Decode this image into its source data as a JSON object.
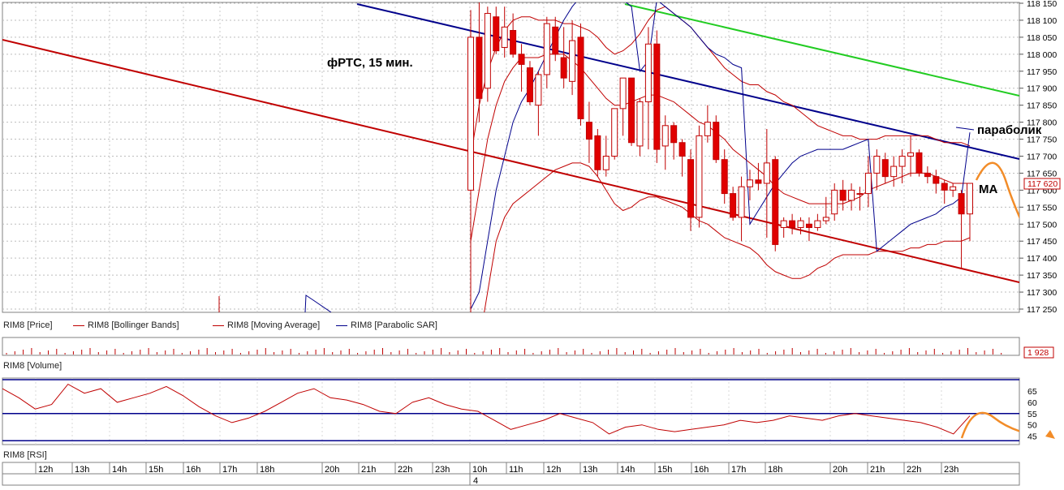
{
  "chart_data": {
    "type": "candlestick",
    "title": "фРТС, 15 мин.",
    "annotations": {
      "parabolic": "параболик",
      "ma": "MA"
    },
    "price_axis": {
      "ticks": [
        "118 150",
        "118 100",
        "118 050",
        "118 000",
        "117 950",
        "117 900",
        "117 850",
        "117 800",
        "117 750",
        "117 700",
        "117 650",
        "117 600",
        "117 550",
        "117 500",
        "117 450",
        "117 400",
        "117 350",
        "117 300",
        "117 250"
      ],
      "range": [
        117250,
        118150
      ],
      "last_price": "117 620"
    },
    "legend": {
      "price": "RIM8 [Price]",
      "bollinger": "RIM8 [Bollinger Bands]",
      "ma": "RIM8 [Moving Average]",
      "sar": "RIM8 [Parabolic SAR]"
    },
    "volume": {
      "label": "RIM8 [Volume]",
      "last_value": "1 928"
    },
    "rsi": {
      "label": "RIM8 [RSI]",
      "ticks": [
        "65",
        "60",
        "55",
        "50",
        "45"
      ],
      "range": [
        42,
        70
      ],
      "levels": [
        70,
        55,
        43
      ]
    },
    "time_axis": {
      "labels": [
        "12h",
        "13h",
        "14h",
        "15h",
        "16h",
        "17h",
        "18h",
        "20h",
        "21h",
        "22h",
        "23h",
        "10h",
        "11h",
        "12h",
        "13h",
        "14h",
        "15h",
        "16h",
        "17h",
        "18h",
        "20h",
        "21h",
        "22h",
        "23h"
      ],
      "date_label": "4"
    },
    "candles": [
      {
        "o": 117600,
        "h": 118130,
        "l": 117230,
        "c": 118050
      },
      {
        "o": 118050,
        "h": 118160,
        "l": 117800,
        "c": 117870
      },
      {
        "o": 117900,
        "h": 118140,
        "l": 117860,
        "c": 118120
      },
      {
        "o": 118110,
        "h": 118140,
        "l": 118000,
        "c": 118010
      },
      {
        "o": 118020,
        "h": 118140,
        "l": 117990,
        "c": 118080
      },
      {
        "o": 118070,
        "h": 118120,
        "l": 117990,
        "c": 118000
      },
      {
        "o": 118000,
        "h": 118030,
        "l": 117890,
        "c": 117970
      },
      {
        "o": 117960,
        "h": 117980,
        "l": 117850,
        "c": 117860
      },
      {
        "o": 117850,
        "h": 117950,
        "l": 117760,
        "c": 117940
      },
      {
        "o": 117940,
        "h": 118110,
        "l": 117900,
        "c": 118090
      },
      {
        "o": 118080,
        "h": 118110,
        "l": 117980,
        "c": 118000
      },
      {
        "o": 117990,
        "h": 118080,
        "l": 117900,
        "c": 117930
      },
      {
        "o": 117920,
        "h": 118100,
        "l": 117880,
        "c": 118040
      },
      {
        "o": 118050,
        "h": 118090,
        "l": 117790,
        "c": 117810
      },
      {
        "o": 117800,
        "h": 117860,
        "l": 117680,
        "c": 117750
      },
      {
        "o": 117760,
        "h": 117780,
        "l": 117640,
        "c": 117660
      },
      {
        "o": 117660,
        "h": 117760,
        "l": 117640,
        "c": 117700
      },
      {
        "o": 117700,
        "h": 117830,
        "l": 117690,
        "c": 117840
      },
      {
        "o": 117840,
        "h": 117930,
        "l": 117760,
        "c": 117930
      },
      {
        "o": 117930,
        "h": 117930,
        "l": 117730,
        "c": 117740
      },
      {
        "o": 117730,
        "h": 117870,
        "l": 117700,
        "c": 117860
      },
      {
        "o": 117860,
        "h": 118080,
        "l": 117720,
        "c": 118030
      },
      {
        "o": 118030,
        "h": 118070,
        "l": 117680,
        "c": 117720
      },
      {
        "o": 117730,
        "h": 117820,
        "l": 117660,
        "c": 117790
      },
      {
        "o": 117790,
        "h": 117800,
        "l": 117690,
        "c": 117740
      },
      {
        "o": 117740,
        "h": 117750,
        "l": 117640,
        "c": 117700
      },
      {
        "o": 117690,
        "h": 117720,
        "l": 117480,
        "c": 117520
      },
      {
        "o": 117520,
        "h": 117790,
        "l": 117490,
        "c": 117760
      },
      {
        "o": 117760,
        "h": 117850,
        "l": 117740,
        "c": 117800
      },
      {
        "o": 117800,
        "h": 117820,
        "l": 117680,
        "c": 117690
      },
      {
        "o": 117690,
        "h": 117720,
        "l": 117560,
        "c": 117590
      },
      {
        "o": 117590,
        "h": 117610,
        "l": 117510,
        "c": 117520
      },
      {
        "o": 117520,
        "h": 117640,
        "l": 117450,
        "c": 117610
      },
      {
        "o": 117610,
        "h": 117660,
        "l": 117570,
        "c": 117630
      },
      {
        "o": 117630,
        "h": 117680,
        "l": 117600,
        "c": 117620
      },
      {
        "o": 117620,
        "h": 117780,
        "l": 117460,
        "c": 117680
      },
      {
        "o": 117690,
        "h": 117700,
        "l": 117420,
        "c": 117440
      },
      {
        "o": 117490,
        "h": 117520,
        "l": 117460,
        "c": 117510
      },
      {
        "o": 117510,
        "h": 117530,
        "l": 117470,
        "c": 117490
      },
      {
        "o": 117490,
        "h": 117520,
        "l": 117470,
        "c": 117510
      },
      {
        "o": 117500,
        "h": 117520,
        "l": 117450,
        "c": 117490
      },
      {
        "o": 117490,
        "h": 117530,
        "l": 117480,
        "c": 117510
      },
      {
        "o": 117510,
        "h": 117580,
        "l": 117500,
        "c": 117520
      },
      {
        "o": 117530,
        "h": 117620,
        "l": 117510,
        "c": 117600
      },
      {
        "o": 117600,
        "h": 117630,
        "l": 117540,
        "c": 117570
      },
      {
        "o": 117570,
        "h": 117620,
        "l": 117540,
        "c": 117600
      },
      {
        "o": 117590,
        "h": 117610,
        "l": 117540,
        "c": 117590
      },
      {
        "o": 117590,
        "h": 117700,
        "l": 117550,
        "c": 117650
      },
      {
        "o": 117650,
        "h": 117720,
        "l": 117600,
        "c": 117700
      },
      {
        "o": 117690,
        "h": 117710,
        "l": 117620,
        "c": 117640
      },
      {
        "o": 117640,
        "h": 117700,
        "l": 117610,
        "c": 117670
      },
      {
        "o": 117670,
        "h": 117720,
        "l": 117620,
        "c": 117700
      },
      {
        "o": 117700,
        "h": 117760,
        "l": 117640,
        "c": 117710
      },
      {
        "o": 117710,
        "h": 117720,
        "l": 117640,
        "c": 117650
      },
      {
        "o": 117650,
        "h": 117670,
        "l": 117620,
        "c": 117640
      },
      {
        "o": 117640,
        "h": 117660,
        "l": 117590,
        "c": 117620
      },
      {
        "o": 117620,
        "h": 117630,
        "l": 117560,
        "c": 117600
      },
      {
        "o": 117600,
        "h": 117620,
        "l": 117580,
        "c": 117610
      },
      {
        "o": 117590,
        "h": 117600,
        "l": 117370,
        "c": 117530
      },
      {
        "o": 117530,
        "h": 117620,
        "l": 117450,
        "c": 117620
      }
    ],
    "bollinger_upper": [
      117700,
      117850,
      117950,
      118020,
      118070,
      118100,
      118110,
      118110,
      118100,
      118100,
      118100,
      118090,
      118090,
      118080,
      118070,
      118050,
      118020,
      118000,
      118010,
      118030,
      118060,
      118100,
      118130,
      118140,
      118120,
      118100,
      118080,
      118050,
      118020,
      117990,
      117960,
      117940,
      117920,
      117910,
      117910,
      117890,
      117880,
      117860,
      117850,
      117830,
      117810,
      117790,
      117780,
      117770,
      117760,
      117760,
      117750,
      117750,
      117750,
      117760,
      117760,
      117760,
      117760,
      117760,
      117760,
      117750,
      117740,
      117740,
      117740,
      117730
    ],
    "bollinger_lower": [
      117000,
      117150,
      117300,
      117450,
      117520,
      117560,
      117580,
      117600,
      117620,
      117640,
      117660,
      117670,
      117680,
      117680,
      117670,
      117640,
      117600,
      117560,
      117540,
      117550,
      117570,
      117580,
      117580,
      117570,
      117560,
      117550,
      117530,
      117510,
      117500,
      117480,
      117460,
      117450,
      117440,
      117430,
      117410,
      117380,
      117360,
      117350,
      117340,
      117340,
      117350,
      117370,
      117380,
      117400,
      117410,
      117410,
      117410,
      117410,
      117420,
      117420,
      117420,
      117420,
      117430,
      117430,
      117440,
      117440,
      117450,
      117450,
      117450,
      117460
    ],
    "moving_average": [
      117450,
      117600,
      117750,
      117850,
      117920,
      117960,
      117990,
      117990,
      117990,
      118000,
      118000,
      118000,
      117980,
      117960,
      117930,
      117900,
      117870,
      117850,
      117850,
      117860,
      117870,
      117880,
      117880,
      117870,
      117860,
      117840,
      117820,
      117800,
      117790,
      117770,
      117750,
      117720,
      117700,
      117680,
      117660,
      117640,
      117610,
      117590,
      117580,
      117570,
      117560,
      117560,
      117560,
      117560,
      117560,
      117570,
      117580,
      117600,
      117610,
      117620,
      117630,
      117640,
      117650,
      117650,
      117650,
      117640,
      117630,
      117620,
      117620,
      117620
    ],
    "parabolic_sar": [
      117250,
      117300,
      117450,
      117600,
      117700,
      117800,
      117860,
      117900,
      117950,
      118000,
      118050,
      118100,
      118140,
      118170,
      118200,
      118200,
      118200,
      118180,
      118160,
      118140,
      117950,
      117980,
      118160,
      118140,
      118120,
      118100,
      118080,
      118050,
      118020,
      118000,
      117990,
      117970,
      117960,
      117500,
      117540,
      117580,
      117620,
      117650,
      117680,
      117700,
      117710,
      117720,
      117720,
      117720,
      117720,
      117730,
      117740,
      117750,
      117420,
      117440,
      117460,
      117480,
      117500,
      117510,
      117520,
      117530,
      117550,
      117560,
      117580,
      117770
    ],
    "rsi_values": [
      66,
      62,
      57,
      59,
      68,
      64,
      66,
      60,
      62,
      64,
      67,
      63,
      58,
      54,
      51,
      53,
      56,
      60,
      64,
      66,
      62,
      61,
      59,
      56,
      55,
      60,
      62,
      59,
      57,
      56,
      52,
      48,
      50,
      52,
      55,
      53,
      51,
      46,
      49,
      50,
      48,
      47,
      48,
      49,
      50,
      52,
      51,
      52,
      54,
      53,
      52,
      54,
      55,
      54,
      53,
      52,
      51,
      49,
      46,
      54
    ]
  }
}
